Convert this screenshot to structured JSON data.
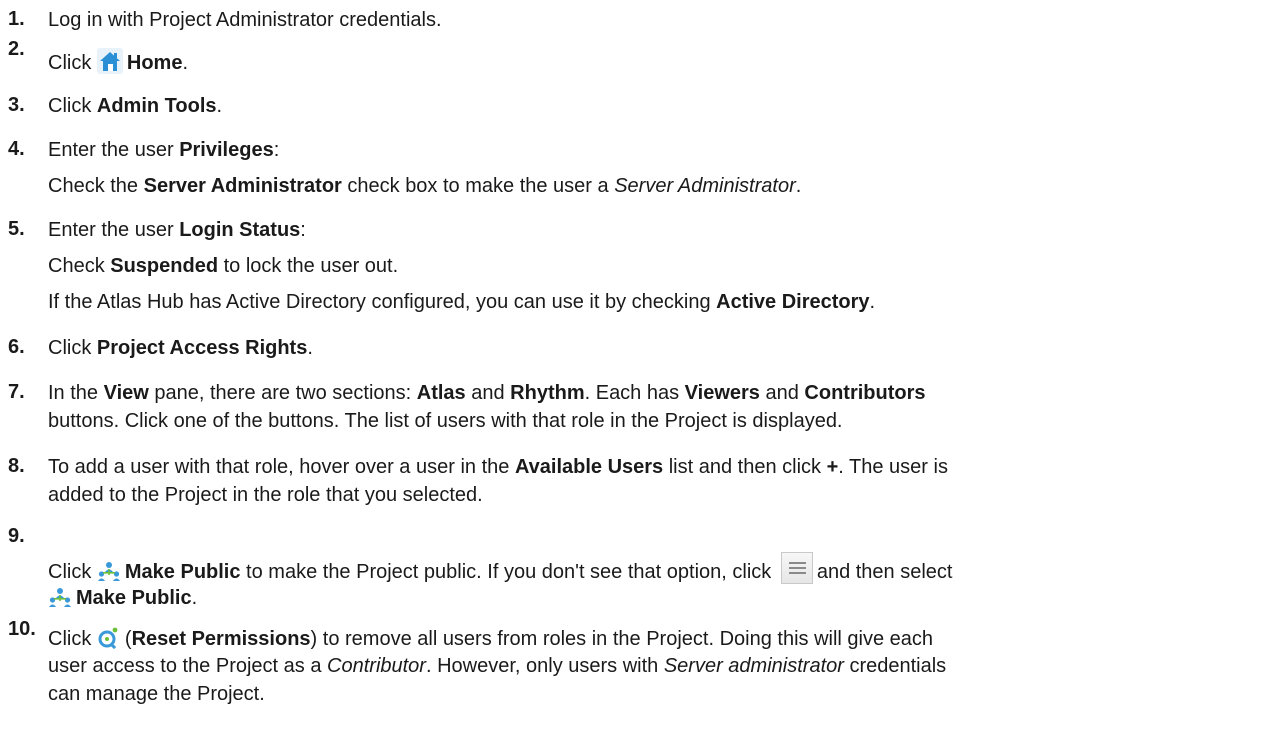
{
  "steps": [
    {
      "num": "1.",
      "lines": [
        [
          "Log in with Project Administrator credentials."
        ]
      ]
    },
    {
      "num": "2.",
      "lines": [
        [
          "Click ",
          "Home",
          "."
        ]
      ]
    },
    {
      "num": "3.",
      "lines": [
        [
          "Click ",
          "Admin Tools",
          "."
        ]
      ]
    },
    {
      "num": "4.",
      "lines": [
        [
          "Enter the user ",
          "Privileges",
          ":"
        ],
        [
          "Check the ",
          "Server Administrator",
          " check box to make the user a ",
          "Server Administrator",
          "."
        ]
      ]
    },
    {
      "num": "5.",
      "lines": [
        [
          "Enter the user ",
          "Login Status",
          ":"
        ],
        [
          "Check ",
          "Suspended",
          " to lock the user out."
        ],
        [
          "If the Atlas Hub has Active Directory configured, you can use it by checking ",
          "Active Directory",
          "."
        ]
      ]
    },
    {
      "num": "6.",
      "lines": [
        [
          "Click ",
          "Project Access Rights",
          "."
        ]
      ]
    },
    {
      "num": "7.",
      "lines": [
        [
          "In the ",
          "View",
          " pane, there are two sections: ",
          "Atlas",
          " and ",
          "Rhythm",
          ". Each has ",
          "Viewers",
          " and ",
          "Contributors"
        ],
        [
          "buttons. Click one of the buttons. The list of users with that role in the Project is displayed."
        ]
      ]
    },
    {
      "num": "8.",
      "lines": [
        [
          "To add a user with that role, hover over a user in the ",
          "Available Users",
          " list and then click ",
          "+",
          ". The user is"
        ],
        [
          "added to the Project in the role that you selected."
        ]
      ]
    },
    {
      "num": "9.",
      "lines": [
        [
          "Click ",
          "Make Public",
          " to make the Project public. If you don't see that option, click ",
          "and then select"
        ],
        [
          "Make Public",
          "."
        ]
      ]
    },
    {
      "num": "10.",
      "lines": [
        [
          "Click ",
          "(",
          "Reset Permissions",
          ") to remove all users from roles in the Project. Doing this will give each"
        ],
        [
          "user access to the Project as a ",
          "Contributor",
          ". However, only users with ",
          "Server administrator",
          " credentials"
        ],
        [
          "can manage the Project."
        ]
      ]
    }
  ],
  "icons": {
    "home": "home-icon",
    "make_public": "make-public-icon",
    "menu": "menu-icon",
    "reset_permissions": "reset-permissions-icon"
  },
  "colors": {
    "home_blue": "#2b8fd6",
    "make_public_blue": "#3a9ad9"
  }
}
